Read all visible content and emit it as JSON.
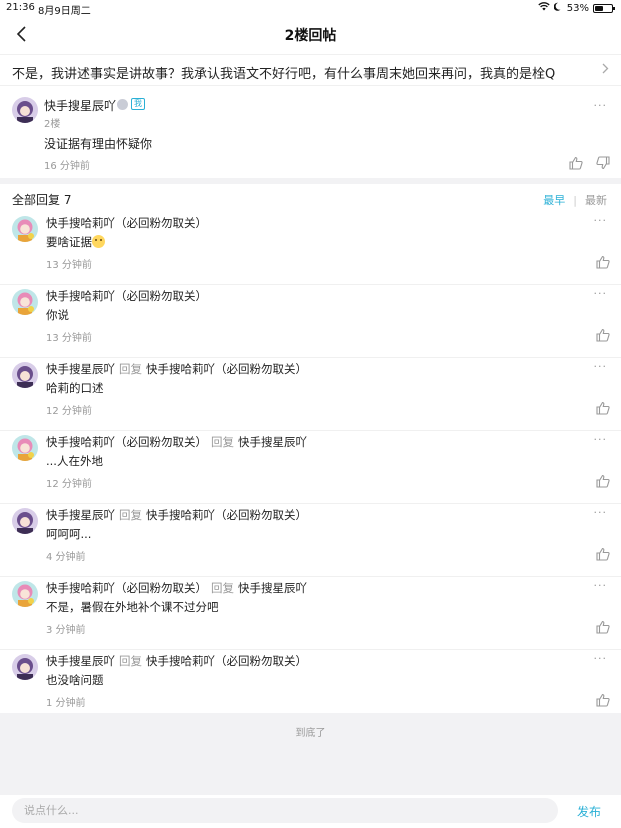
{
  "status_bar": {
    "time": "21:36",
    "date": "8月9日周二",
    "battery": "53%",
    "battery_level": 0.53
  },
  "nav": {
    "title": "2楼回帖"
  },
  "topic": {
    "text": "不是，我讲述事实是讲故事？我承认我语文不好行吧，有什么事周末她回来再问，我真的是栓Q"
  },
  "main_post": {
    "author": "快手搜星辰吖",
    "badge_tag": "我",
    "floor": "2楼",
    "content": "没证据有理由怀疑你",
    "time": "16 分钟前",
    "more": "···"
  },
  "replies_header": {
    "title": "全部回复 7",
    "sort_earliest": "最早",
    "sort_latest": "最新"
  },
  "replies": [
    {
      "author": "快手搜哈莉吖（必回粉勿取关）",
      "reply_label": "",
      "reply_to": "",
      "content": "要啥证据",
      "time": "13 分钟前",
      "avatar": "halle"
    },
    {
      "author": "快手搜哈莉吖（必回粉勿取关）",
      "reply_label": "",
      "reply_to": "",
      "content": "你说",
      "time": "13 分钟前",
      "avatar": "halle"
    },
    {
      "author": "快手搜星辰吖",
      "reply_label": "回复",
      "reply_to": "快手搜哈莉吖（必回粉勿取关）",
      "content": "哈莉的口述",
      "time": "12 分钟前",
      "avatar": "xingchen"
    },
    {
      "author": "快手搜哈莉吖（必回粉勿取关）",
      "reply_label": "回复",
      "reply_to": "快手搜星辰吖",
      "content": "...人在外地",
      "time": "12 分钟前",
      "avatar": "halle"
    },
    {
      "author": "快手搜星辰吖",
      "reply_label": "回复",
      "reply_to": "快手搜哈莉吖（必回粉勿取关）",
      "content": "呵呵呵...",
      "time": "4 分钟前",
      "avatar": "xingchen"
    },
    {
      "author": "快手搜哈莉吖（必回粉勿取关）",
      "reply_label": "回复",
      "reply_to": "快手搜星辰吖",
      "content": "不是，暑假在外地补个课不过分吧",
      "time": "3 分钟前",
      "avatar": "halle"
    },
    {
      "author": "快手搜星辰吖",
      "reply_label": "回复",
      "reply_to": "快手搜哈莉吖（必回粉勿取关）",
      "content": "也没啥问题",
      "time": "1 分钟前",
      "avatar": "xingchen"
    }
  ],
  "footer": {
    "end_text": "到底了"
  },
  "input_bar": {
    "placeholder": "说点什么...",
    "send_label": "发布"
  },
  "colors": {
    "accent": "#2ab0d6",
    "muted": "#999999",
    "band": "#f2f2f4"
  },
  "icons": [
    "back-arrow-icon",
    "wifi-icon",
    "moon-icon",
    "battery-icon",
    "chevron-right-icon",
    "more-icon",
    "thumb-up-icon",
    "thumb-down-icon",
    "emoji-icon"
  ]
}
